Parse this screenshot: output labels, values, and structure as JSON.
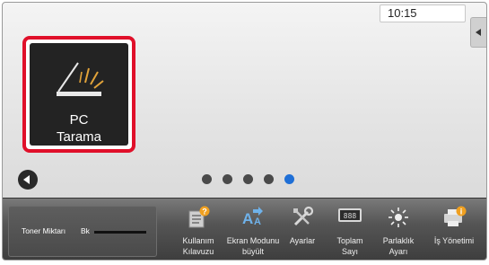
{
  "status_bar": {
    "time": "10:15"
  },
  "home": {
    "app_tile": {
      "label_line1": "PC",
      "label_line2": "Tarama"
    },
    "pages": {
      "count": 5,
      "active_index": 4
    }
  },
  "dock": {
    "toner": {
      "label": "Toner Miktarı",
      "color_label": "Bk"
    },
    "buttons": [
      {
        "line1": "Kullanım",
        "line2": "Kılavuzu",
        "icon": "manual-icon"
      },
      {
        "line1": "Ekran Modunu",
        "line2": "büyült",
        "icon": "magnify-text-icon"
      },
      {
        "line1": "Ayarlar",
        "line2": "",
        "icon": "settings-tools-icon"
      },
      {
        "line1": "Toplam",
        "line2": "Sayı",
        "icon": "counter-icon"
      },
      {
        "line1": "Parlaklık",
        "line2": "Ayarı",
        "icon": "brightness-icon"
      },
      {
        "line1": "İş Yönetimi",
        "line2": "",
        "icon": "job-status-icon"
      }
    ]
  },
  "colors": {
    "highlight": "#e0102a",
    "active_dot": "#1f6fd6",
    "tile_bg": "#232323"
  }
}
